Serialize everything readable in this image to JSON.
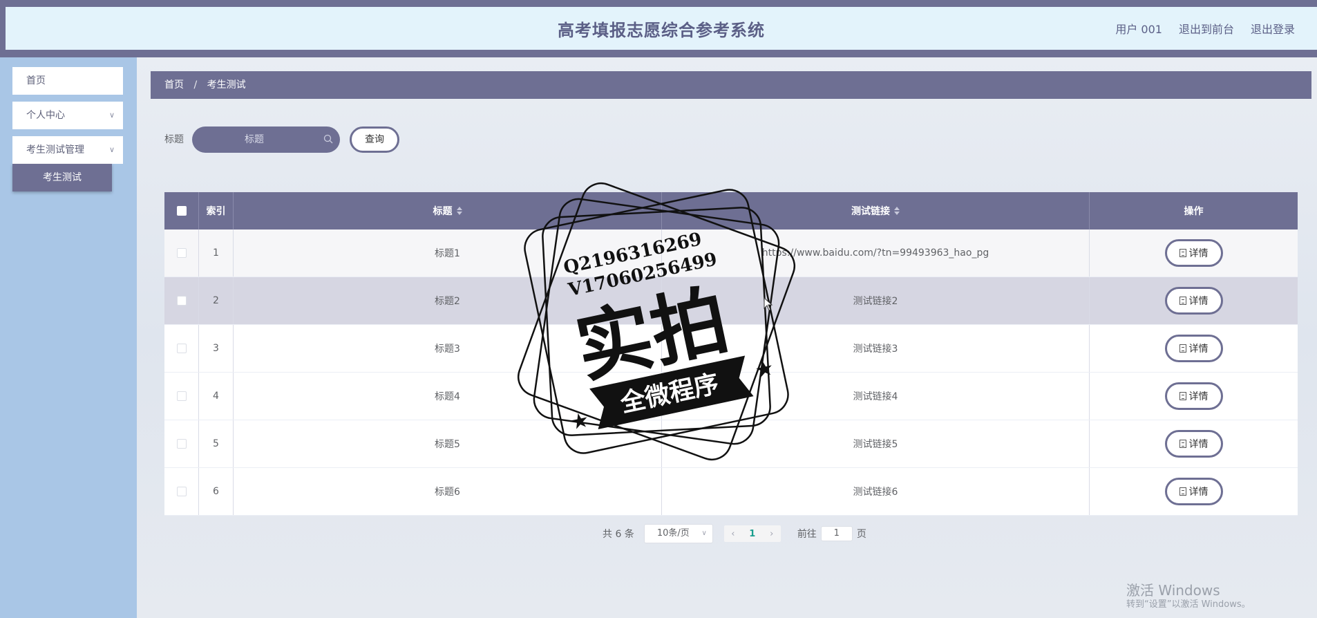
{
  "header": {
    "title": "高考填报志愿综合参考系统",
    "user": "用户 001",
    "back_to_front": "退出到前台",
    "logout": "退出登录"
  },
  "sidebar": {
    "items": [
      {
        "label": "首页"
      },
      {
        "label": "个人中心"
      },
      {
        "label": "考生测试管理"
      }
    ],
    "active_sub": "考生测试"
  },
  "breadcrumb": {
    "home": "首页",
    "sep": "/",
    "current": "考生测试"
  },
  "search": {
    "label": "标题",
    "placeholder": "标题",
    "button": "查询"
  },
  "table": {
    "headers": {
      "index": "索引",
      "title": "标题",
      "link": "测试链接",
      "op": "操作"
    },
    "rows": [
      {
        "index": "1",
        "title": "标题1",
        "link": "https://www.baidu.com/?tn=99493963_hao_pg",
        "op": "详情"
      },
      {
        "index": "2",
        "title": "标题2",
        "link": "测试链接2",
        "op": "详情"
      },
      {
        "index": "3",
        "title": "标题3",
        "link": "测试链接3",
        "op": "详情"
      },
      {
        "index": "4",
        "title": "标题4",
        "link": "测试链接4",
        "op": "详情"
      },
      {
        "index": "5",
        "title": "标题5",
        "link": "测试链接5",
        "op": "详情"
      },
      {
        "index": "6",
        "title": "标题6",
        "link": "测试链接6",
        "op": "详情"
      }
    ]
  },
  "pagination": {
    "total": "共 6 条",
    "page_size": "10条/页",
    "current": "1",
    "goto_label": "前往",
    "goto_value": "1",
    "page_unit": "页"
  },
  "watermark": {
    "line1": "Q2196316269",
    "line2": "V17060256499",
    "main": "实拍",
    "banner": "全微程序"
  },
  "windows_activation": {
    "line1": "激活 Windows",
    "line2": "转到“设置”以激活 Windows。"
  },
  "colors": {
    "accent": "#6e6f93",
    "header_bg": "#e3f3fb",
    "sidebar_bg": "#a9c6e6"
  }
}
